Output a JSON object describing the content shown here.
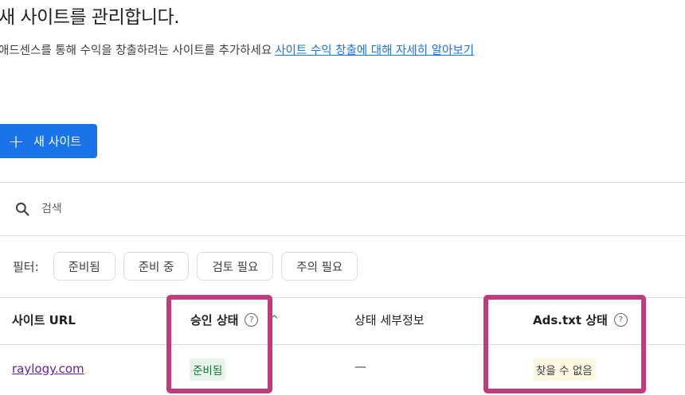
{
  "page": {
    "title": "새 사이트를 관리합니다.",
    "description": "애드센스를 통해 수익을 창출하려는 사이트를 추가하세요",
    "learn_more_link": "사이트 수익 창출에 대해 자세히 알아보기",
    "new_site_button": "새 사이트"
  },
  "search": {
    "placeholder": "검색"
  },
  "filters": {
    "label": "필터:",
    "chips": [
      "준비됨",
      "준비 중",
      "검토 필요",
      "주의 필요"
    ]
  },
  "table": {
    "columns": {
      "site_url": "사이트 URL",
      "approval_status": "승인 상태",
      "status_details": "상태 세부정보",
      "ads_txt_status": "Ads.txt 상태"
    },
    "rows": [
      {
        "site_url": "raylogy.com",
        "approval_status": "준비됨",
        "status_details": "—",
        "ads_txt_status": "찾을 수 없음"
      }
    ]
  },
  "colors": {
    "primary": "#1a73e8",
    "highlight": "#c13b7c",
    "ready_bg": "#e6f4ea",
    "ready_text": "#137333",
    "warning_bg": "#fef7e0",
    "visited_link": "#681da8"
  },
  "icons": {
    "search": "search-icon",
    "help": "help-circle-icon",
    "plus": "plus-icon",
    "sort": "sort-arrow-up-icon"
  }
}
